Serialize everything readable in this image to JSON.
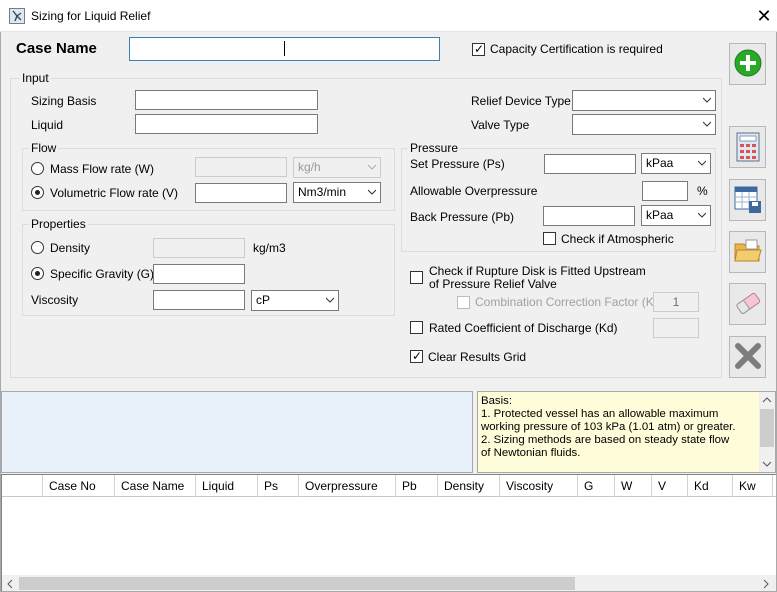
{
  "window": {
    "title": "Sizing for Liquid Relief",
    "close_glyph": "✕"
  },
  "case": {
    "label": "Case Name",
    "value": ""
  },
  "capacity_certification": {
    "label": "Capacity Certification is required",
    "checked": true
  },
  "input": {
    "title": "Input",
    "sizing_basis": {
      "label": "Sizing Basis",
      "value": ""
    },
    "liquid": {
      "label": "Liquid",
      "value": ""
    },
    "relief_device_type": {
      "label": "Relief Device Type",
      "value": ""
    },
    "valve_type": {
      "label": "Valve Type",
      "value": ""
    }
  },
  "flow": {
    "title": "Flow",
    "mass": {
      "label": "Mass Flow rate (W)",
      "selected": false,
      "unit": "kg/h"
    },
    "volumetric": {
      "label": "Volumetric Flow rate (V)",
      "selected": true,
      "unit": "Nm3/min"
    }
  },
  "properties": {
    "title": "Properties",
    "density": {
      "label": "Density",
      "selected": false,
      "unit": "kg/m3"
    },
    "specific_gravity": {
      "label": "Specific Gravity (G)",
      "selected": true
    },
    "viscosity": {
      "label": "Viscosity",
      "unit": "cP"
    }
  },
  "pressure": {
    "title": "Pressure",
    "set_pressure": {
      "label": "Set Pressure (Ps)",
      "unit": "kPaa"
    },
    "allowable_overpressure": {
      "label": "Allowable Overpressure",
      "unit": "%"
    },
    "back_pressure": {
      "label": "Back Pressure (Pb)",
      "unit": "kPaa"
    },
    "atmospheric": {
      "label": "Check if Atmospheric",
      "checked": false
    }
  },
  "options": {
    "rupture_disk": {
      "label": "Check if Rupture Disk is Fitted Upstream of Pressure Relief Valve",
      "checked": false
    },
    "combination_factor": {
      "label": "Combination Correction Factor (Kc)",
      "checked": false,
      "value": "1"
    },
    "rated_coefficient": {
      "label": "Rated Coefficient of Discharge (Kd)",
      "checked": false,
      "value": ""
    },
    "clear_results": {
      "label": "Clear Results Grid",
      "checked": true
    }
  },
  "toolbar": {
    "icons": [
      "add-icon",
      "calculator-icon",
      "save-icon",
      "open-folder-icon",
      "eraser-icon",
      "delete-icon"
    ]
  },
  "basis": {
    "text": "Basis:\n1. Protected vessel has an allowable maximum working pressure of 103 kPa (1.01 atm) or greater.\n2. Sizing methods are based on steady state flow of Newtonian fluids."
  },
  "results_grid": {
    "columns": [
      "",
      "Case No",
      "Case Name",
      "Liquid",
      "Ps",
      "Overpressure",
      "Pb",
      "Density",
      "Viscosity",
      "G",
      "W",
      "V",
      "Kd",
      "Kw"
    ]
  },
  "colors": {
    "add_green": "#2aa82a",
    "basis_bg": "#fffdd9",
    "left_panel_bg": "#e9f1fa"
  }
}
